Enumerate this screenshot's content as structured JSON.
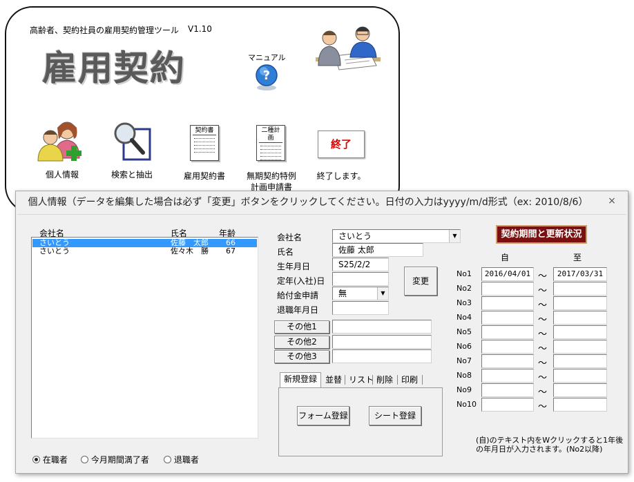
{
  "launcher": {
    "subtitle": "高齢者、契約社員の雇用契約管理ツール",
    "version": "V1.10",
    "big_title": "雇用契約",
    "manual_label": "マニュアル",
    "items": [
      {
        "label": "個人情報"
      },
      {
        "label": "検索と抽出"
      },
      {
        "label": "雇用契約書",
        "doc_header": "契約書"
      },
      {
        "label_line1": "無期契約特例",
        "label_line2": "計画申請書",
        "doc_header": "二種計画"
      },
      {
        "label": "終了します。",
        "button": "終了"
      }
    ],
    "exit_color": "#e00000"
  },
  "dialog": {
    "title": "個人情報（データを編集した場合は必ず「変更」ボタンをクリックしてください。日付の入力はyyyy/m/d形式（ex: 2010/8/6）",
    "close": "×",
    "list": {
      "headers": {
        "company": "会社名",
        "name": "氏名",
        "age": "年齢"
      },
      "rows": [
        {
          "company": "さいとう",
          "name": "佐藤　太郎",
          "age": "66",
          "selected": true
        },
        {
          "company": "さいとう",
          "name": "佐々木　勝",
          "age": "67",
          "selected": false
        }
      ],
      "selection_color": "#3399ff"
    },
    "form": {
      "company_label": "会社名",
      "company_value": "さいとう",
      "name_label": "氏名",
      "name_value": "佐藤 太郎",
      "birth_label": "生年月日",
      "birth_value": "S25/2/2",
      "retire_label": "定年(入社)日",
      "retire_value": "",
      "benefit_label": "給付金申請",
      "benefit_value": "無",
      "leave_label": "退職年月日",
      "leave_value": "",
      "change_button": "変更",
      "other1_button": "その他1",
      "other2_button": "その他2",
      "other3_button": "その他3"
    },
    "tabs": [
      "新規登録",
      "並替",
      "リスト",
      "削除",
      "印刷"
    ],
    "tab_buttons": {
      "form_register": "フォーム登録",
      "sheet_register": "シート登録"
    },
    "status": {
      "button": "契約期間と更新状況",
      "button_color": "#7a1010",
      "from_header": "自",
      "to_header": "至",
      "tilde": "～",
      "rows": [
        {
          "no": "No1",
          "from": "2016/04/01",
          "to": "2017/03/31"
        },
        {
          "no": "No2",
          "from": "",
          "to": ""
        },
        {
          "no": "No3",
          "from": "",
          "to": ""
        },
        {
          "no": "No4",
          "from": "",
          "to": ""
        },
        {
          "no": "No5",
          "from": "",
          "to": ""
        },
        {
          "no": "No6",
          "from": "",
          "to": ""
        },
        {
          "no": "No7",
          "from": "",
          "to": ""
        },
        {
          "no": "No8",
          "from": "",
          "to": ""
        },
        {
          "no": "No9",
          "from": "",
          "to": ""
        },
        {
          "no": "No10",
          "from": "",
          "to": ""
        }
      ],
      "note_line1": "(自)のテキスト内をWクリックすると1年後",
      "note_line2": "の年月日が入力されます。(No2以降)"
    },
    "radios": [
      {
        "label": "在職者",
        "checked": true
      },
      {
        "label": "今月期間満了者",
        "checked": false
      },
      {
        "label": "退職者",
        "checked": false
      }
    ]
  }
}
